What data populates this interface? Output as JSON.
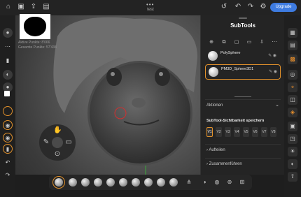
{
  "app": {
    "title": "test",
    "upgrade_label": "Upgrade"
  },
  "stats": {
    "active_points": "Aktive Punkte: 8'066",
    "total_points": "Gesamte Punkte: 57'434"
  },
  "subtools": {
    "title": "SubTools",
    "items": [
      {
        "name": "PolySphere",
        "selected": false
      },
      {
        "name": "PM3D_Sphere3D1",
        "selected": true
      }
    ],
    "actions_label": "Aktionen",
    "visibility_title": "SubTool-Sichtbarkeit speichern",
    "visibility_buttons": [
      "V1",
      "V2",
      "V3",
      "V4",
      "V5",
      "V6",
      "V7",
      "V8"
    ],
    "split_label": "Aufteilen",
    "merge_label": "Zusammenführen"
  },
  "colors": {
    "accent": "#e0902b",
    "upgrade": "#3e7be0"
  }
}
